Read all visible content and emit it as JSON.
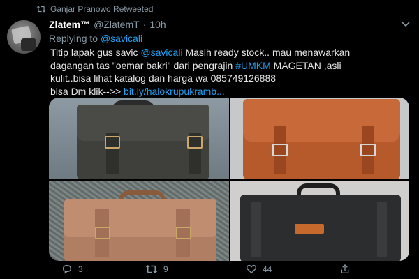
{
  "retweet": {
    "text": "Ganjar Pranowo Retweeted"
  },
  "tweet": {
    "author_name": "Zlatem™",
    "handle": "@ZlatemT",
    "separator": "·",
    "time": "10h",
    "replying_prefix": "Replying to",
    "replying_to": "@savicali",
    "text": {
      "l1_a": "Titip lapak gus savic ",
      "l1_mention": "@savicali",
      "l1_b": " Masih ready stock.. mau menawarkan",
      "l2_a": "dagangan  tas \"oemar bakri\" dari pengrajin ",
      "l2_hashtag": "#UMKM",
      "l2_b": " MAGETAN ,asli",
      "l3": "kulit..bisa lihat katalog dan harga wa 085749126888",
      "l4_a": " bisa Dm klik-->> ",
      "l4_link": "bit.ly/halokrupukramb..."
    }
  },
  "actions": {
    "replies": "3",
    "retweets": "9",
    "likes": "44"
  },
  "icons": {
    "retweet_small": "retweet-icon",
    "more": "more-icon",
    "reply": "reply-icon",
    "retweet": "retweet-icon",
    "like": "heart-icon",
    "share": "share-icon"
  },
  "colors": {
    "background": "#000000",
    "link": "#1da1f2",
    "muted": "#8899a6"
  }
}
